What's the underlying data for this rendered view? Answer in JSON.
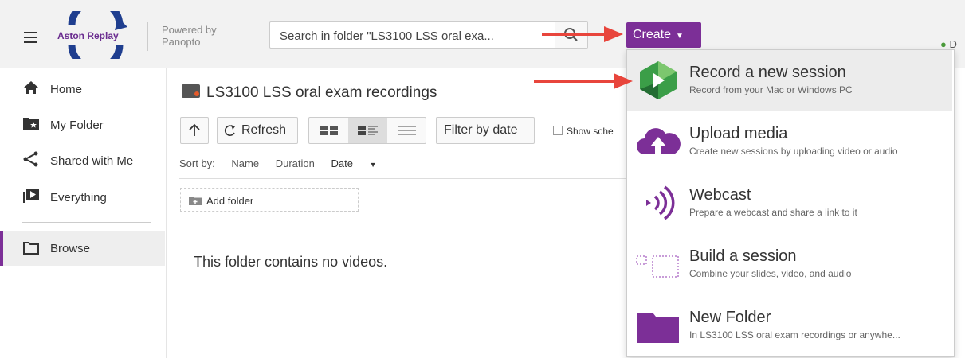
{
  "header": {
    "app_name": "Aston Replay",
    "powered_by": "Powered by",
    "panopto": "Panopto",
    "search_placeholder": "Search in folder \"LS3100 LSS oral exa...",
    "create_label": "Create",
    "user_initial": "D"
  },
  "sidebar": {
    "items": [
      {
        "label": "Home",
        "icon": "home-icon"
      },
      {
        "label": "My Folder",
        "icon": "my-folder-icon"
      },
      {
        "label": "Shared with Me",
        "icon": "share-icon"
      },
      {
        "label": "Everything",
        "icon": "everything-icon"
      },
      {
        "label": "Browse",
        "icon": "folder-outline-icon"
      }
    ]
  },
  "main": {
    "folder_title": "LS3100 LSS oral exam recordings",
    "refresh_label": "Refresh",
    "filter_label": "Filter by date",
    "show_scheduled": "Show sche",
    "sort_by": "Sort by:",
    "sort_name": "Name",
    "sort_duration": "Duration",
    "sort_date": "Date",
    "add_folder": "Add folder",
    "empty_message": "This folder contains no videos."
  },
  "dropdown": {
    "items": [
      {
        "title": "Record a new session",
        "subtitle": "Record from your Mac or Windows PC",
        "icon": "panopto-record-icon"
      },
      {
        "title": "Upload media",
        "subtitle": "Create new sessions by uploading video or audio",
        "icon": "cloud-upload-icon"
      },
      {
        "title": "Webcast",
        "subtitle": "Prepare a webcast and share a link to it",
        "icon": "webcast-icon"
      },
      {
        "title": "Build a session",
        "subtitle": "Combine your slides, video, and audio",
        "icon": "build-session-icon"
      },
      {
        "title": "New Folder",
        "subtitle": "In LS3100 LSS oral exam recordings or anywhe...",
        "icon": "folder-icon"
      }
    ]
  },
  "colors": {
    "accent": "#7c2f97",
    "arrow": "#e8453c",
    "logo_blue": "#1f3e8f"
  }
}
